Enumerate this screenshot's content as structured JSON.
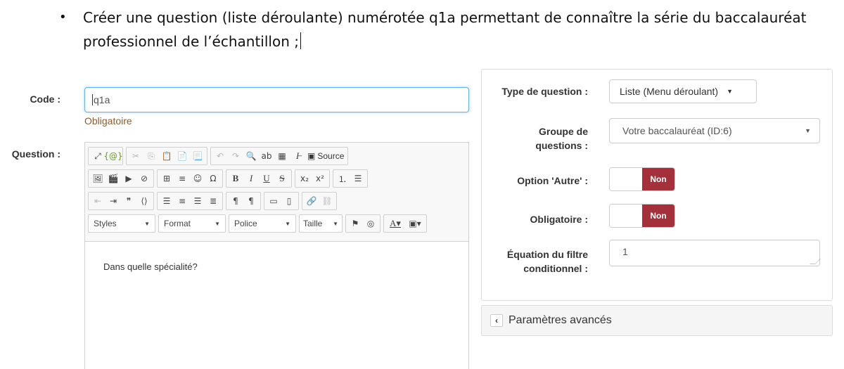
{
  "instruction": {
    "bullet": "•",
    "text": "Créer une question (liste déroulante) numérotée q1a permettant de connaître la série du baccalauréat professionnel de l’échantillon ;"
  },
  "form": {
    "code_label": "Code :",
    "code_value": "q1a",
    "required_text": "Obligatoire",
    "question_label": "Question :",
    "editor": {
      "source_label": "Source",
      "styles_label": "Styles",
      "format_label": "Format",
      "police_label": "Police",
      "taille_label": "Taille",
      "content": "Dans quelle spécialité?"
    }
  },
  "settings": {
    "type_label": "Type de question :",
    "type_value": "Liste (Menu déroulant)",
    "group_label_line1": "Groupe de",
    "group_label_line2": "questions :",
    "group_value": "Votre baccalauréat (ID:6)",
    "other_label": "Option 'Autre' :",
    "other_toggle": "Non",
    "mandatory_label": "Obligatoire :",
    "mandatory_toggle": "Non",
    "filter_label_line1": "Équation du filtre",
    "filter_label_line2": "conditionnel :",
    "filter_value": "1",
    "advanced_label": "Paramètres avancés"
  },
  "colors": {
    "toggle_off": "#a4303c",
    "focus_border": "#66afe9",
    "required_text": "#8a5a2f"
  }
}
